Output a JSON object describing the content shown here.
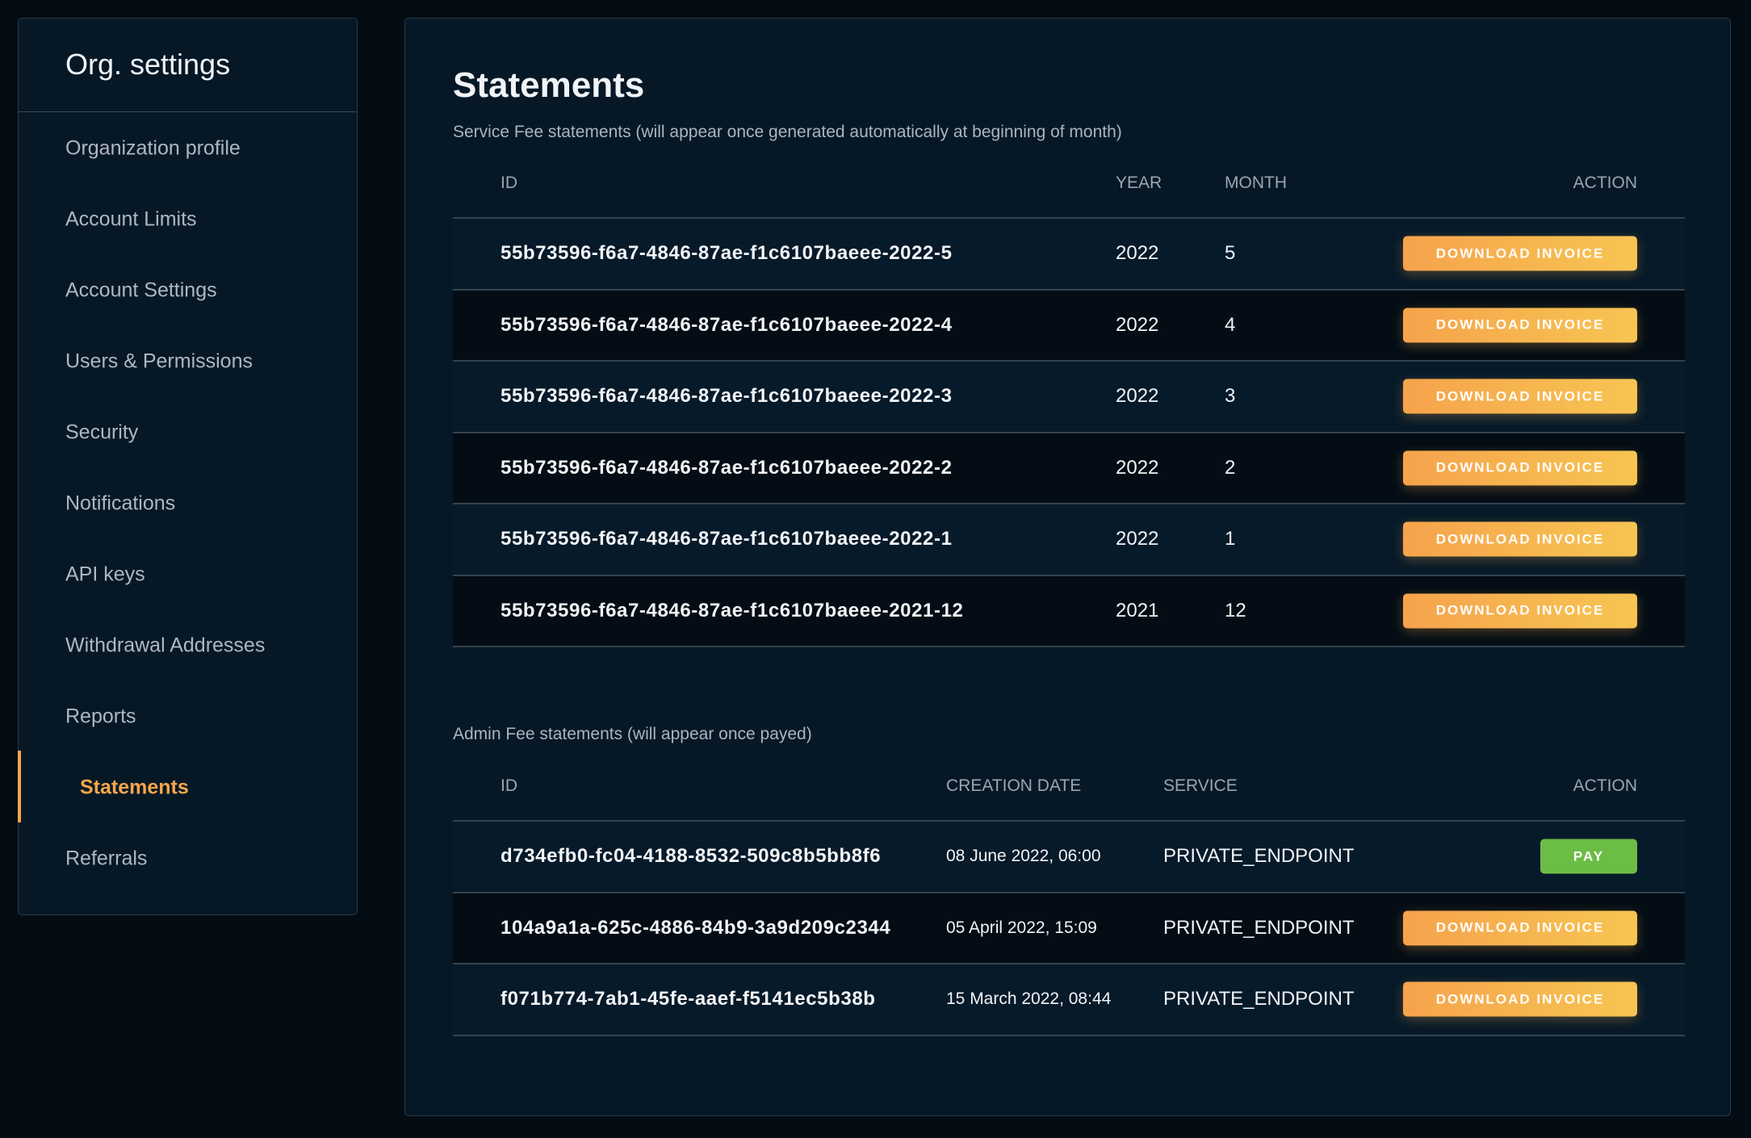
{
  "sidebar": {
    "title": "Org. settings",
    "items": [
      {
        "label": "Organization profile"
      },
      {
        "label": "Account Limits"
      },
      {
        "label": "Account Settings"
      },
      {
        "label": "Users & Permissions"
      },
      {
        "label": "Security"
      },
      {
        "label": "Notifications"
      },
      {
        "label": "API keys"
      },
      {
        "label": "Withdrawal Addresses"
      },
      {
        "label": "Reports"
      },
      {
        "label": "Statements",
        "active": true
      },
      {
        "label": "Referrals"
      }
    ],
    "accent": "#f7a54a"
  },
  "main": {
    "title": "Statements",
    "service": {
      "description": "Service Fee statements (will appear once generated automatically at beginning of month)",
      "headers": {
        "id": "ID",
        "year": "YEAR",
        "month": "MONTH",
        "action": "ACTION"
      },
      "rows": [
        {
          "id": "55b73596-f6a7-4846-87ae-f1c6107baeee-2022-5",
          "year": "2022",
          "month": "5",
          "action": "DOWNLOAD INVOICE"
        },
        {
          "id": "55b73596-f6a7-4846-87ae-f1c6107baeee-2022-4",
          "year": "2022",
          "month": "4",
          "action": "DOWNLOAD INVOICE"
        },
        {
          "id": "55b73596-f6a7-4846-87ae-f1c6107baeee-2022-3",
          "year": "2022",
          "month": "3",
          "action": "DOWNLOAD INVOICE"
        },
        {
          "id": "55b73596-f6a7-4846-87ae-f1c6107baeee-2022-2",
          "year": "2022",
          "month": "2",
          "action": "DOWNLOAD INVOICE"
        },
        {
          "id": "55b73596-f6a7-4846-87ae-f1c6107baeee-2022-1",
          "year": "2022",
          "month": "1",
          "action": "DOWNLOAD INVOICE"
        },
        {
          "id": "55b73596-f6a7-4846-87ae-f1c6107baeee-2021-12",
          "year": "2021",
          "month": "12",
          "action": "DOWNLOAD INVOICE"
        }
      ]
    },
    "admin": {
      "description": "Admin Fee statements (will appear once payed)",
      "headers": {
        "id": "ID",
        "date": "CREATION DATE",
        "service": "SERVICE",
        "action": "ACTION"
      },
      "rows": [
        {
          "id": "d734efb0-fc04-4188-8532-509c8b5bb8f6",
          "date": "08 June 2022, 06:00",
          "service": "PRIVATE_ENDPOINT",
          "action": "PAY",
          "type": "pay"
        },
        {
          "id": "104a9a1a-625c-4886-84b9-3a9d209c2344",
          "date": "05 April 2022, 15:09",
          "service": "PRIVATE_ENDPOINT",
          "action": "DOWNLOAD INVOICE",
          "type": "download"
        },
        {
          "id": "f071b774-7ab1-45fe-aaef-f5141ec5b38b",
          "date": "15 March 2022, 08:44",
          "service": "PRIVATE_ENDPOINT",
          "action": "DOWNLOAD INVOICE",
          "type": "download"
        }
      ]
    },
    "colors": {
      "download_button": "#f6a34c",
      "pay_button": "#6cbd45"
    }
  }
}
